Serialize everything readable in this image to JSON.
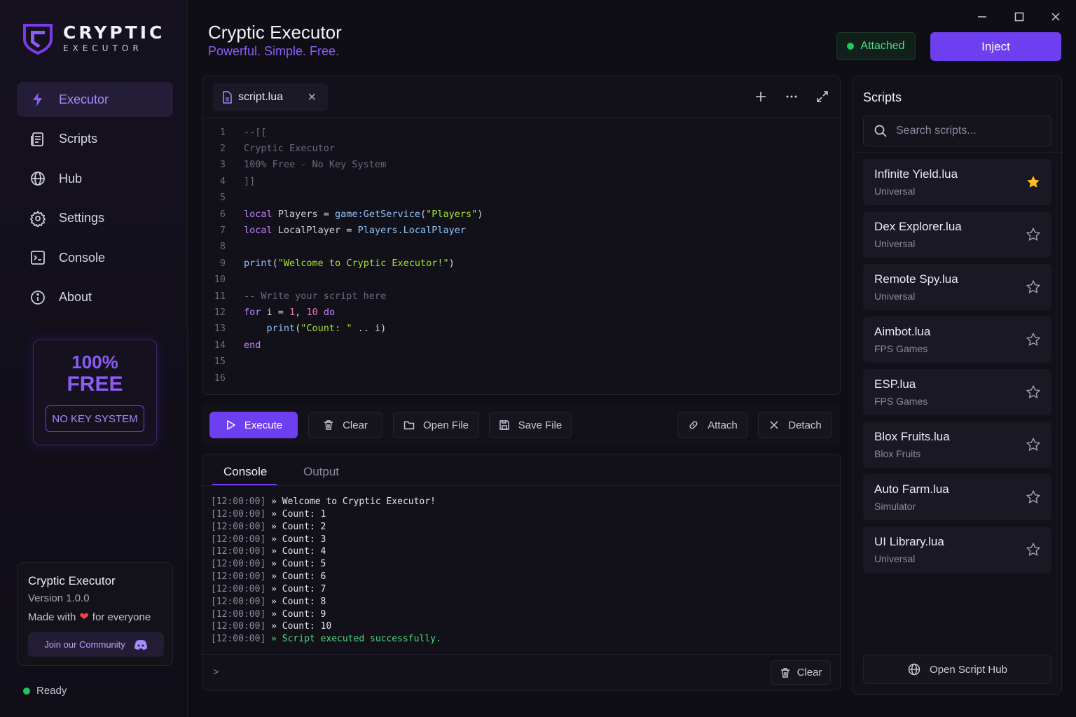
{
  "window": {
    "title": "Cryptic Executor",
    "subtitle": "Powerful. Simple. Free.",
    "controls": [
      "minimize-icon",
      "maximize-icon",
      "close-icon"
    ]
  },
  "brand": {
    "title": "CRYPTIC",
    "sub": "EXECUTOR",
    "accent": "#7c3aed"
  },
  "sidebar": {
    "items": [
      {
        "label": "Executor",
        "icon": "lightning-icon",
        "active": true
      },
      {
        "label": "Scripts",
        "icon": "scripts-icon",
        "active": false
      },
      {
        "label": "Hub",
        "icon": "globe-icon",
        "active": false
      },
      {
        "label": "Settings",
        "icon": "gear-icon",
        "active": false
      },
      {
        "label": "Console",
        "icon": "terminal-icon",
        "active": false
      },
      {
        "label": "About",
        "icon": "info-icon",
        "active": false
      }
    ],
    "promo": {
      "line1": "100%",
      "line2": "FREE",
      "button": "NO KEY SYSTEM"
    },
    "info": {
      "title": "Cryptic Executor",
      "version": "Version 1.0.0",
      "made_prefix": "Made with",
      "made_suffix": "for everyone",
      "community": "Join our Community"
    },
    "status": "Ready"
  },
  "header": {
    "attached": "Attached",
    "inject": "Inject"
  },
  "editor": {
    "tab": "script.lua",
    "lines": [
      "1",
      "2",
      "3",
      "4",
      "5",
      "6",
      "7",
      "8",
      "9",
      "10",
      "11",
      "12",
      "13",
      "14",
      "15",
      "16"
    ],
    "code": {
      "l1": "--[[",
      "l2": "Cryptic Executor",
      "l3": "100% Free - No Key System",
      "l4": "]]",
      "l6_kw": "local",
      "l6_var": " Players = ",
      "l6_fn": "game:GetService",
      "l6_p1": "(",
      "l6_str": "\"Players\"",
      "l6_p2": ")",
      "l7_kw": "local",
      "l7_var": " LocalPlayer = ",
      "l7_ref": "Players.LocalPlayer",
      "l9_fn": "print",
      "l9_p1": "(",
      "l9_str": "\"Welcome to Cryptic Executor!\"",
      "l9_p2": ")",
      "l11": "-- Write your script here",
      "l12_kw": "for",
      "l12_a": " i = ",
      "l12_n1": "1",
      "l12_b": ", ",
      "l12_n2": "10",
      "l12_c": " ",
      "l12_kw2": "do",
      "l13_indent": "    ",
      "l13_fn": "print",
      "l13_p1": "(",
      "l13_str": "\"Count: \"",
      "l13_rest": " .. i)",
      "l14_kw": "end"
    }
  },
  "toolbar": {
    "execute": "Execute",
    "clear": "Clear",
    "open": "Open File",
    "save": "Save File",
    "attach": "Attach",
    "detach": "Detach"
  },
  "console": {
    "tabs": [
      "Console",
      "Output"
    ],
    "log": [
      {
        "ts": "[12:00:00]",
        "msg": " » Welcome to Cryptic Executor!",
        "ok": false
      },
      {
        "ts": "[12:00:00]",
        "msg": " » Count: 1",
        "ok": false
      },
      {
        "ts": "[12:00:00]",
        "msg": " » Count: 2",
        "ok": false
      },
      {
        "ts": "[12:00:00]",
        "msg": " » Count: 3",
        "ok": false
      },
      {
        "ts": "[12:00:00]",
        "msg": " » Count: 4",
        "ok": false
      },
      {
        "ts": "[12:00:00]",
        "msg": " » Count: 5",
        "ok": false
      },
      {
        "ts": "[12:00:00]",
        "msg": " » Count: 6",
        "ok": false
      },
      {
        "ts": "[12:00:00]",
        "msg": " » Count: 7",
        "ok": false
      },
      {
        "ts": "[12:00:00]",
        "msg": " » Count: 8",
        "ok": false
      },
      {
        "ts": "[12:00:00]",
        "msg": " » Count: 9",
        "ok": false
      },
      {
        "ts": "[12:00:00]",
        "msg": " » Count: 10",
        "ok": false
      },
      {
        "ts": "[12:00:00]",
        "msg": " » Script executed successfully.",
        "ok": true
      }
    ],
    "prompt": ">",
    "clear": "Clear"
  },
  "scripts": {
    "title": "Scripts",
    "search_placeholder": "Search scripts...",
    "items": [
      {
        "name": "Infinite Yield.lua",
        "category": "Universal",
        "favorite": true
      },
      {
        "name": "Dex Explorer.lua",
        "category": "Universal",
        "favorite": false
      },
      {
        "name": "Remote Spy.lua",
        "category": "Universal",
        "favorite": false
      },
      {
        "name": "Aimbot.lua",
        "category": "FPS Games",
        "favorite": false
      },
      {
        "name": "ESP.lua",
        "category": "FPS Games",
        "favorite": false
      },
      {
        "name": "Blox Fruits.lua",
        "category": "Blox Fruits",
        "favorite": false
      },
      {
        "name": "Auto Farm.lua",
        "category": "Simulator",
        "favorite": false
      },
      {
        "name": "UI Library.lua",
        "category": "Universal",
        "favorite": false
      }
    ],
    "hub_button": "Open Script Hub"
  }
}
